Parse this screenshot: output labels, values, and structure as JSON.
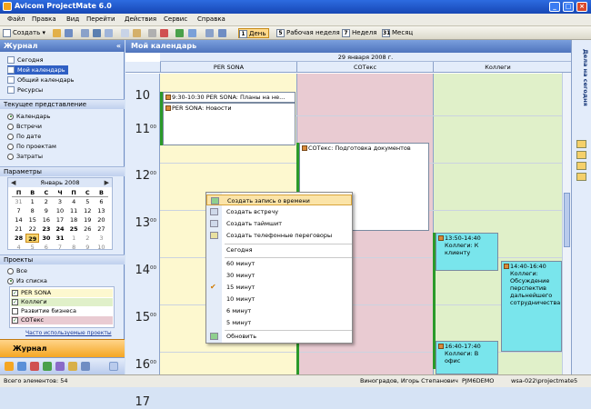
{
  "window": {
    "title": "Avicom ProjectMate 6.0"
  },
  "menu": [
    "Файл",
    "Правка",
    "Вид",
    "Перейти",
    "Действия",
    "Сервис",
    "Справка"
  ],
  "toolbar": {
    "create": "Создать ▾",
    "day": "День",
    "workweek": "Рабочая неделя",
    "week": "Неделя",
    "month": "Месяц",
    "day_num": "1",
    "workweek_num": "5",
    "week_num": "7",
    "month_num": "31"
  },
  "left": {
    "header": "Журнал",
    "nav_items": [
      "Сегодня",
      "Мой календарь",
      "Общий календарь",
      "Ресурсы"
    ],
    "current_view_header": "Текущее представление",
    "views": [
      "Календарь",
      "Встречи",
      "По дате",
      "По проектам",
      "Затраты"
    ],
    "params_header": "Параметры",
    "minical": {
      "month": "Январь 2008",
      "daynames": [
        "П",
        "В",
        "С",
        "Ч",
        "П",
        "С",
        "В"
      ],
      "weeks": [
        [
          "31",
          "1",
          "2",
          "3",
          "4",
          "5",
          "6"
        ],
        [
          "7",
          "8",
          "9",
          "10",
          "11",
          "12",
          "13"
        ],
        [
          "14",
          "15",
          "16",
          "17",
          "18",
          "19",
          "20"
        ],
        [
          "21",
          "22",
          "23",
          "24",
          "25",
          "26",
          "27"
        ],
        [
          "28",
          "29",
          "30",
          "31",
          "1",
          "2",
          "3"
        ],
        [
          "4",
          "5",
          "6",
          "7",
          "8",
          "9",
          "10"
        ]
      ]
    },
    "projects_header": "Проекты",
    "project_filter": [
      "Все",
      "Из списка"
    ],
    "projects": [
      "PER SONA",
      "Коллеги",
      "Развитие бизнеса",
      "СОТекс"
    ],
    "more_link": "Часто используемые проекты",
    "nav_button": "Журнал"
  },
  "main": {
    "header": "Мой календарь",
    "date": "29 января 2008 г.",
    "columns": [
      "PER SONA",
      "СОТекс",
      "Коллеги"
    ],
    "hours": [
      "10",
      "11",
      "12",
      "13",
      "14",
      "15",
      "16",
      "17"
    ],
    "minutes": "00",
    "events": [
      {
        "text": "9:30-10:30 PER SONA: Планы на не..."
      },
      {
        "text": "PER SONA: Новости"
      },
      {
        "text": "СОТекс: Подготовка документов"
      },
      {
        "text": "13:50-14:40 Коллеги: К клиенту"
      },
      {
        "text": "14:40-16:40 Коллеги: Обсуждение перспектив дальнейшего сотрудничества"
      },
      {
        "text": "16:40-17:40 Коллеги: В офис"
      }
    ]
  },
  "context_menu": {
    "items": [
      "Создать запись о времени",
      "Создать встречу",
      "Создать таймшит",
      "Создать телефонные переговоры",
      "Сегодня",
      "60 минут",
      "30 минут",
      "15 минут",
      "10 минут",
      "6 минут",
      "5 минут",
      "Обновить"
    ]
  },
  "rightbar": {
    "label": "Дела на сегодня"
  },
  "status": {
    "count": "Всего элементов: 54",
    "user": "Виноградов, Игорь Степанович",
    "db": "PJM6DEMO",
    "server": "wsa-022\\projectmate5"
  },
  "colors": {
    "persona": "#fdf8cf",
    "sotex": "#e9cbd2",
    "colleagues": "#e0f0c9",
    "event_teal": "#79e5ec",
    "accent": "#f5a623"
  }
}
